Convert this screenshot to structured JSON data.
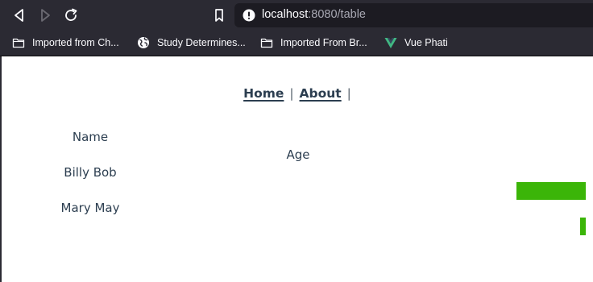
{
  "browser": {
    "url_host": "localhost",
    "url_rest": ":8080/table",
    "bookmarks": [
      {
        "label": "Imported from Ch...",
        "icon": "folder-icon"
      },
      {
        "label": "Study Determines...",
        "icon": "globe-icon"
      },
      {
        "label": "Imported From Br...",
        "icon": "folder-icon"
      },
      {
        "label": "Vue Phati",
        "icon": "vue-logo-icon"
      }
    ]
  },
  "nav": {
    "home": "Home",
    "separator": "|",
    "about": "About"
  },
  "table": {
    "headers": {
      "name": "Name",
      "age": "Age"
    },
    "rows": [
      {
        "name": "Billy Bob",
        "bar_level": 1.0
      },
      {
        "name": "Mary May",
        "bar_level": 0.08
      }
    ]
  },
  "colors": {
    "bar": "#3bb508",
    "text": "#2c3e50",
    "chrome": "#2b2a33"
  }
}
